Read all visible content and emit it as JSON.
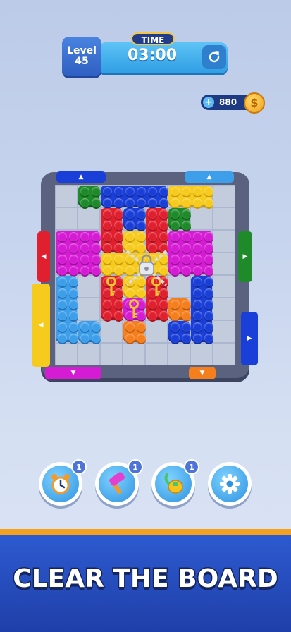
{
  "hud": {
    "level_label": "Level",
    "level_number": "45",
    "time_label": "TIME",
    "timer": "03:00",
    "coins": "880",
    "coin_symbol": "$",
    "add_symbol": "+"
  },
  "board": {
    "gate_arrow_up": "▲",
    "gate_arrow_down": "▼",
    "gate_arrow_left": "◀",
    "gate_arrow_right": "▶"
  },
  "boosters": [
    {
      "name": "alarm-clock",
      "count": "1"
    },
    {
      "name": "hammer",
      "count": "1"
    },
    {
      "name": "vacuum",
      "count": "1"
    },
    {
      "name": "settings",
      "count": ""
    }
  ],
  "banner": {
    "headline": "CLEAR THE BOARD"
  },
  "colors": {
    "red": "#e0202e",
    "yellow": "#f6cb1d",
    "blue": "#1a3fd8",
    "light_blue": "#3d9ee9",
    "magenta": "#d51bd3",
    "green": "#1e8a2a",
    "orange": "#f57e1d"
  }
}
